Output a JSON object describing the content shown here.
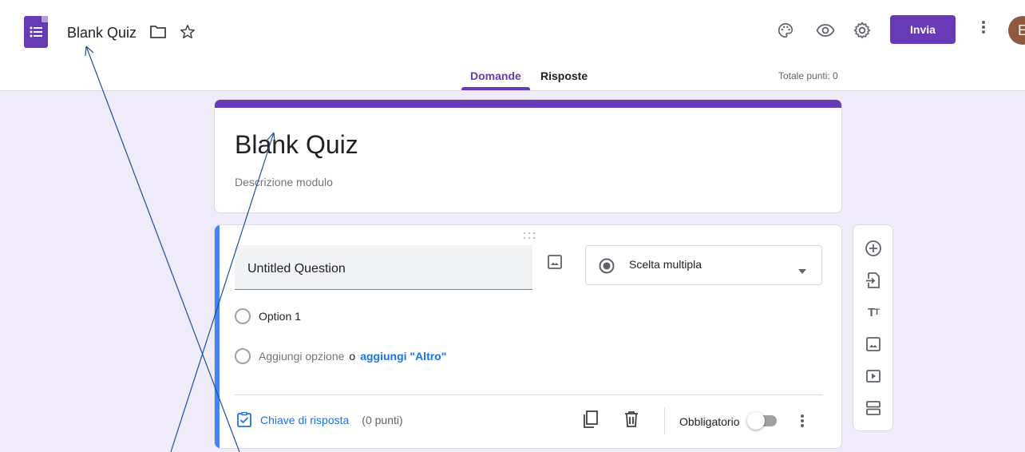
{
  "header": {
    "doc_title": "Blank Quiz",
    "send_label": "Invia",
    "avatar_initial": "E",
    "icons": [
      "palette-icon",
      "eye-icon",
      "gear-icon",
      "more-vert-icon"
    ]
  },
  "tabs": [
    {
      "label": "Domande",
      "active": true
    },
    {
      "label": "Risposte",
      "active": false
    }
  ],
  "total_points": "Totale punti: 0",
  "form": {
    "title": "Blank Quiz",
    "description_placeholder": "Descrizione modulo"
  },
  "question": {
    "title": "Untitled Question",
    "type": "Scelta multipla",
    "options": [
      "Option 1"
    ],
    "add_option": "Aggiungi opzione",
    "add_or": "o",
    "add_other": "aggiungi \"Altro\"",
    "answer_key": "Chiave di risposta",
    "points": "(0 punti)",
    "required_label": "Obbligatorio",
    "required": false
  },
  "side_toolbar": [
    "add-circle-icon",
    "import-question-icon",
    "title-text-icon",
    "image-icon",
    "video-icon",
    "section-icon"
  ],
  "colors": {
    "accent": "#673ab7",
    "background": "#f0ebf8",
    "link": "#1a73e8",
    "question_focus": "#4285f4"
  }
}
